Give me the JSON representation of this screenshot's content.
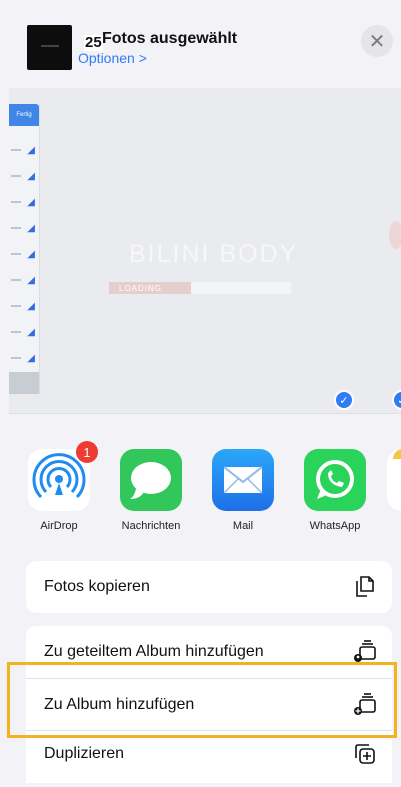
{
  "header": {
    "count": "25",
    "title": "Fotos ausgewählt",
    "options_label": "Optionen >",
    "close_symbol": "✕"
  },
  "preview": {
    "done_label": "Fertig",
    "splash_text": "BILINI BODY",
    "loading_text": "LOADING",
    "loading_progress": 0.45
  },
  "apps": [
    {
      "name": "AirDrop",
      "icon": "airdrop-icon",
      "badge": "1",
      "color": "#ffffff"
    },
    {
      "name": "Nachrichten",
      "icon": "messages-icon",
      "color": "#31c75b"
    },
    {
      "name": "Mail",
      "icon": "mail-icon",
      "color": "#2f86f5"
    },
    {
      "name": "WhatsApp",
      "icon": "whatsapp-icon",
      "color": "#2ad35a"
    }
  ],
  "actions": [
    {
      "label": "Fotos kopieren",
      "icon": "copy-icon"
    },
    {
      "label": "Zu geteiltem Album hinzufügen",
      "icon": "shared-album-icon"
    },
    {
      "label": "Zu Album hinzufügen",
      "icon": "add-to-album-icon"
    },
    {
      "label": "Duplizieren",
      "icon": "duplicate-icon"
    }
  ],
  "colors": {
    "accent": "#2f7cf6",
    "highlight": "#f2b322",
    "badge": "#ee3b33"
  }
}
